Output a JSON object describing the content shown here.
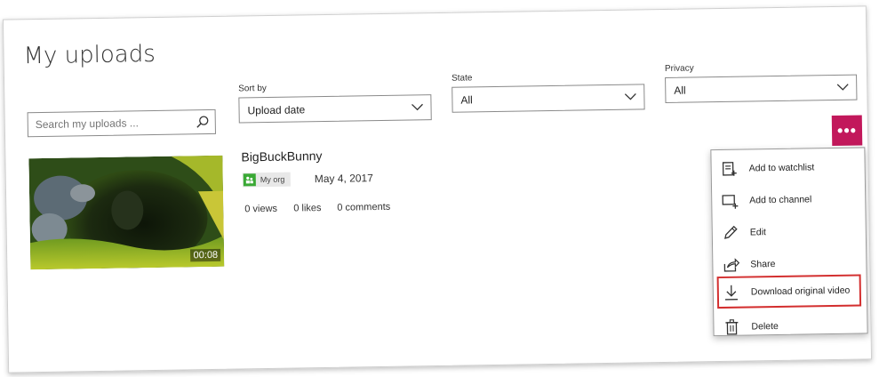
{
  "page": {
    "title": "My uploads"
  },
  "search": {
    "placeholder": "Search my uploads ..."
  },
  "filters": {
    "sort": {
      "label": "Sort by",
      "value": "Upload date"
    },
    "state": {
      "label": "State",
      "value": "All"
    },
    "privacy": {
      "label": "Privacy",
      "value": "All"
    }
  },
  "more_button": {
    "label": "•••"
  },
  "video": {
    "title": "BigBuckBunny",
    "duration": "00:08",
    "org": "My org",
    "date": "May 4, 2017",
    "views": "0 views",
    "likes": "0 likes",
    "comments": "0 comments"
  },
  "menu": {
    "items": [
      {
        "label": "Add to watchlist",
        "icon": "watchlist-icon"
      },
      {
        "label": "Add to channel",
        "icon": "channel-icon"
      },
      {
        "label": "Edit",
        "icon": "pencil-icon"
      },
      {
        "label": "Share",
        "icon": "share-icon"
      },
      {
        "label": "Download original video",
        "icon": "download-icon",
        "highlighted": true
      },
      {
        "label": "Delete",
        "icon": "trash-icon"
      }
    ]
  },
  "colors": {
    "accent": "#c2185b",
    "org_badge": "#3aa935",
    "highlight_outline": "#d32f2f"
  }
}
